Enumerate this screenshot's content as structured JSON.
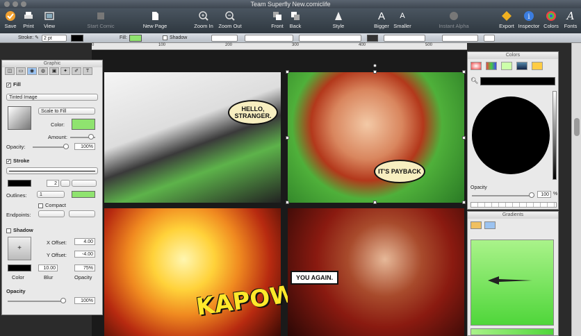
{
  "window": {
    "title": "Team Superfly New.comiclife"
  },
  "toolbar": {
    "save": "Save",
    "print": "Print",
    "view": "View",
    "start_comic": "Start Comic",
    "new_page": "New Page",
    "zoom_in": "Zoom In",
    "zoom_out": "Zoom Out",
    "front": "Front",
    "back": "Back",
    "style": "Style",
    "bigger": "Bigger",
    "smaller": "Smaller",
    "instant_alpha": "Instant Alpha",
    "export": "Export",
    "inspector": "Inspector",
    "colors": "Colors",
    "fonts": "Fonts"
  },
  "stylebar": {
    "stroke_label": "Stroke:",
    "stroke_value": "2 pt",
    "fill_label": "Fill:",
    "shadow_label": "Shadow"
  },
  "ruler": {
    "marks": [
      "0",
      "100",
      "200",
      "300",
      "400",
      "500"
    ]
  },
  "comic": {
    "bubble1": "HELLO, STRANGER.",
    "bubble2": "IT'S PAYBACK",
    "caption": "YOU AGAIN.",
    "kapow": "KAPOW!"
  },
  "graphic_panel": {
    "title": "Graphic",
    "fill_label": "Fill",
    "fill_type": "Tinted Image",
    "scale_mode": "Scale to Fill",
    "color_label": "Color:",
    "amount_label": "Amount:",
    "opacity_label": "Opacity:",
    "opacity_value": "100%",
    "stroke_label": "Stroke",
    "stroke_width": "2",
    "outlines_label": "Outlines:",
    "outlines_value": "1",
    "compact_label": "Compact",
    "endpoints_label": "Endpoints:",
    "shadow_label": "Shadow",
    "x_offset_label": "X Offset:",
    "x_offset_value": "4.00",
    "y_offset_label": "Y Offset:",
    "y_offset_value": "-4.00",
    "blur_value": "10.00",
    "shadow_opacity_value": "75%",
    "color_caption": "Color",
    "blur_caption": "Blur",
    "opacity_caption": "Opacity",
    "opacity2_label": "Opacity",
    "opacity2_value": "100%"
  },
  "colors_panel": {
    "title": "Colors",
    "opacity_label": "Opacity",
    "opacity_value": "100",
    "percent": "%"
  },
  "gradients_panel": {
    "title": "Gradients"
  },
  "colors": {
    "fill_green": "#8fe36f",
    "accent_blue": "#3b7de0"
  }
}
